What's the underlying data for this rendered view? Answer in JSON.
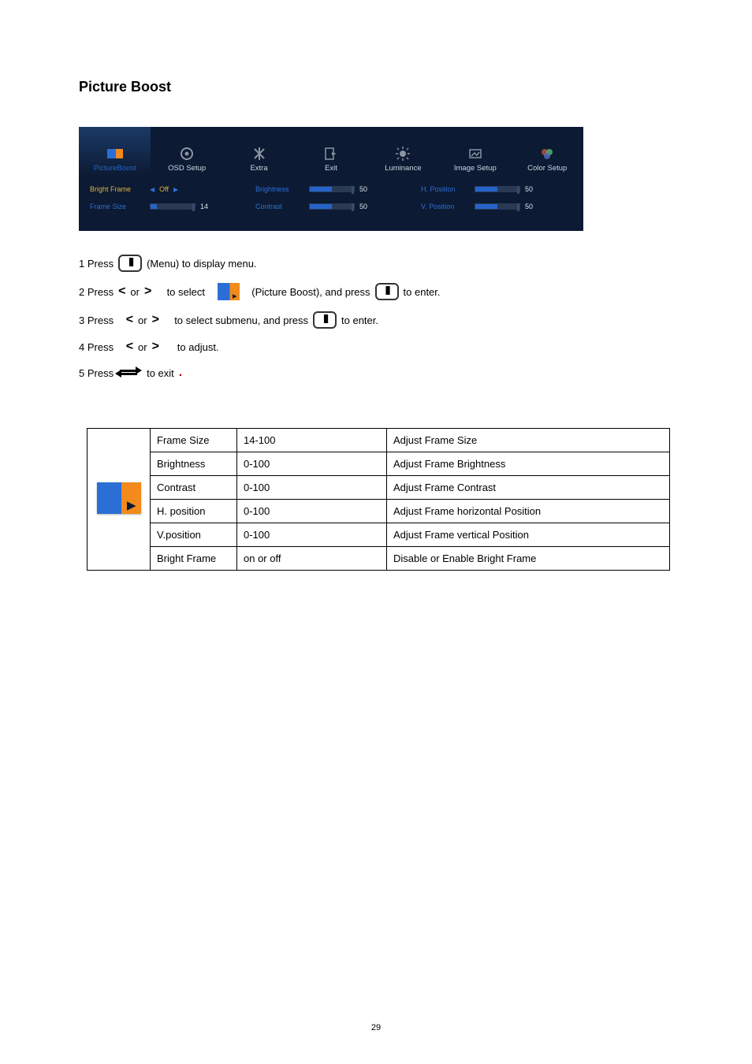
{
  "heading": "Picture Boost",
  "osd": {
    "tabs": [
      {
        "label": "PictureBoost"
      },
      {
        "label": "OSD Setup"
      },
      {
        "label": "Extra"
      },
      {
        "label": "Exit"
      },
      {
        "label": "Luminance"
      },
      {
        "label": "Image Setup"
      },
      {
        "label": "Color Setup"
      }
    ],
    "rows": {
      "bright_frame_label": "Bright Frame",
      "bright_frame_value": "Off",
      "frame_size_label": "Frame Size",
      "frame_size_value": "14",
      "brightness_label": "Brightness",
      "brightness_value": "50",
      "contrast_label": "Contrast",
      "contrast_value": "50",
      "hpos_label": "H. Position",
      "hpos_value": "50",
      "vpos_label": "V. Position",
      "vpos_value": "50"
    }
  },
  "steps": {
    "s1a": "1 Press",
    "s1b": "(Menu) to display menu.",
    "s2a": "2 Press",
    "s2b": "or",
    "s2c": "to select",
    "s2d": "(Picture Boost), and press",
    "s2e": "to enter.",
    "s3a": "3 Press",
    "s3b": "or",
    "s3c": "to select submenu, and press",
    "s3d": "to enter.",
    "s4a": "4 Press",
    "s4b": "or",
    "s4c": "to adjust.",
    "s5a": "5 Press",
    "s5b": "to exit",
    "dot": "."
  },
  "table": [
    {
      "name": "Frame Size",
      "range": "14-100",
      "desc": "Adjust Frame Size"
    },
    {
      "name": "Brightness",
      "range": "0-100",
      "desc": "Adjust Frame Brightness"
    },
    {
      "name": "Contrast",
      "range": "0-100",
      "desc": "Adjust Frame Contrast"
    },
    {
      "name": "H. position",
      "range": "0-100",
      "desc": "Adjust Frame horizontal Position"
    },
    {
      "name": "V.position",
      "range": "0-100",
      "desc": "Adjust Frame vertical Position"
    },
    {
      "name": "Bright Frame",
      "range": "on or off",
      "desc": "Disable or Enable Bright Frame"
    }
  ],
  "page_number": "29"
}
